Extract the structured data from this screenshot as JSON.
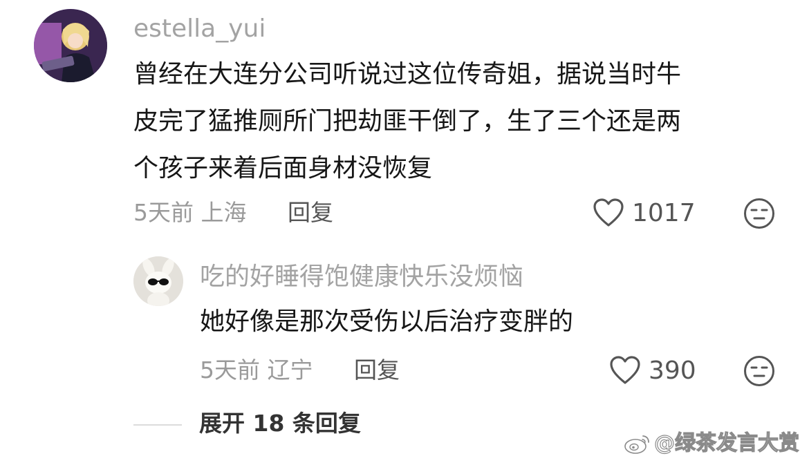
{
  "comment": {
    "username": "estella_yui",
    "text_line1": "曾经在大连分公司听说过这位传奇姐，据说当时牛",
    "text_line2": "皮完了猛推厕所门把劫匪干倒了，生了三个还是两",
    "text_line3": "个孩子来着后面身材没恢复",
    "meta": "5天前 上海",
    "reply_label": "回复",
    "likes": "1017",
    "avatar_icon": "anime-girl-avatar",
    "like_icon": "heart-outline-icon",
    "dislike_icon": "neutral-face-icon"
  },
  "reply": {
    "username": "吃的好睡得饱健康快乐没烦恼",
    "text": "她好像是那次受伤以后治疗变胖的",
    "meta": "5天前 辽宁",
    "reply_label": "回复",
    "likes": "390",
    "avatar_icon": "bunny-sunglasses-avatar",
    "like_icon": "heart-outline-icon",
    "dislike_icon": "neutral-face-icon"
  },
  "expand": {
    "label": "展开 18 条回复"
  },
  "watermark": {
    "text": "@绿茶发言大赏",
    "icon": "weibo-logo-icon"
  },
  "colors": {
    "username": "#a3a3a3",
    "text": "#161616",
    "meta": "#9a9a9a",
    "icon": "#555555"
  }
}
